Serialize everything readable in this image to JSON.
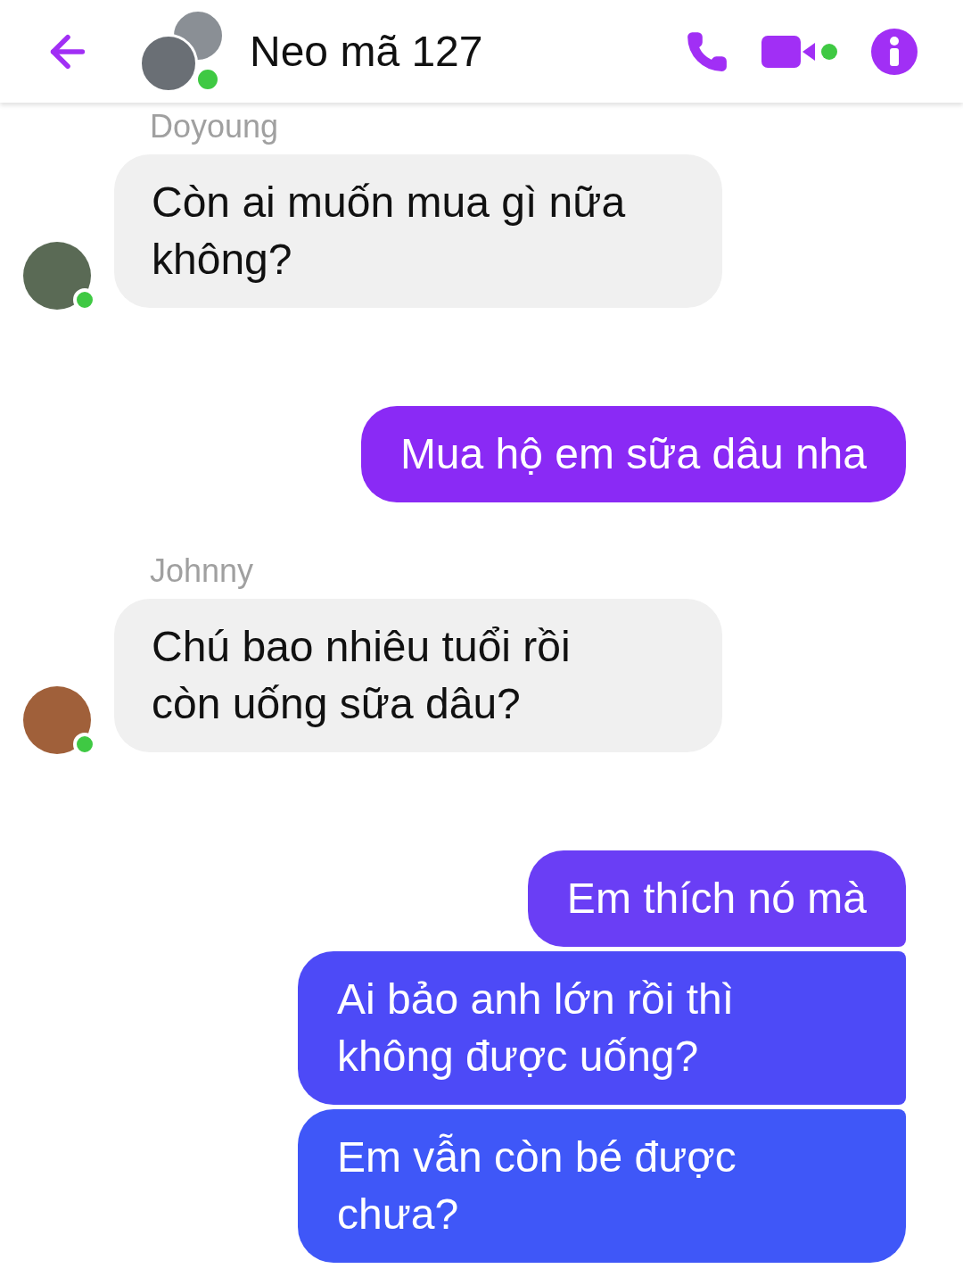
{
  "header": {
    "title": "Neo mã 127",
    "online": true,
    "video_online": true
  },
  "messages": [
    {
      "kind": "incoming",
      "sender": "Doyoung",
      "online": true,
      "bubbles": [
        {
          "text": "Còn ai muốn mua gì nữa\nkhông?"
        }
      ]
    },
    {
      "kind": "outgoing",
      "bubbles": [
        {
          "text": "Mua hộ em sữa dâu nha",
          "color": "#8a2af5"
        }
      ]
    },
    {
      "kind": "incoming",
      "sender": "Johnny",
      "online": true,
      "bubbles": [
        {
          "text": "Chú bao nhiêu tuổi rồi\ncòn uống sữa dâu?"
        }
      ]
    },
    {
      "kind": "outgoing",
      "bubbles": [
        {
          "text": "Em thích nó mà",
          "color": "#6a3ef5"
        },
        {
          "text": "Ai bảo anh lớn rồi thì\nkhông được uống?",
          "color": "#4d4af7"
        },
        {
          "text": "Em vẫn còn bé được\nchưa?",
          "color": "#3f57f8"
        }
      ]
    }
  ]
}
